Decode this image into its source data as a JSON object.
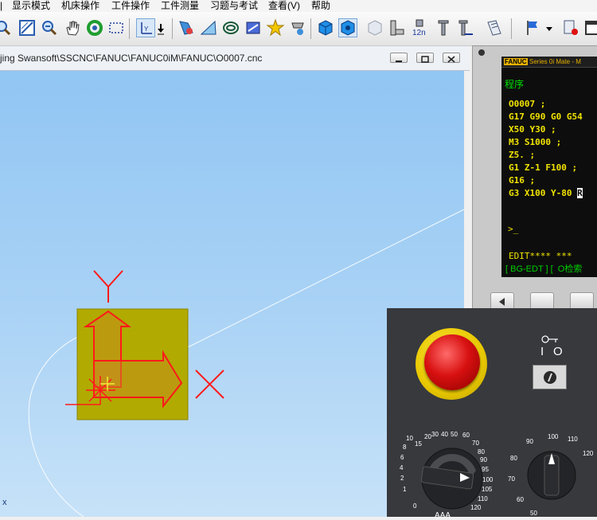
{
  "menu": {
    "items": [
      "显示模式",
      "机床操作",
      "工件操作",
      "工件测量",
      "习题与考试",
      "查看(V)",
      "帮助"
    ]
  },
  "toolbar": {
    "icons": [
      "zoom-icon",
      "zoom-window-icon",
      "zoom-fit-icon",
      "pan-hand-icon",
      "rotate-icon",
      "select-box-icon",
      "axis-view-icon",
      "dropdown-icon",
      "tool-measure-icon",
      "ruler-icon",
      "spiral-icon",
      "workpiece-icon",
      "star-icon",
      "coolant-icon",
      "blue-cube-icon",
      "blue-cube-alt-icon",
      "transparent-cube-icon",
      "spindle-12n-icon",
      "tool-length-icon",
      "tool-radius-icon",
      "notebook-icon",
      "flag-icon",
      "dropdown-icon-2",
      "record-icon",
      "window-toggle-icon"
    ]
  },
  "viewport": {
    "path": "jing Swansoft\\SSCNC\\FANUC\\FANUC0iM\\FANUC\\O0007.cnc",
    "axis_y": "Y",
    "axis_x": "X",
    "corner_label": "x"
  },
  "cnc": {
    "brand": "FANUC",
    "series": "Series 0i Mate - M",
    "title": "程序",
    "lines": [
      "O0007 ;",
      "G17 G90 G0 G54",
      "X50 Y30 ;",
      "M3 S1000 ;",
      "Z5. ;",
      "G1 Z-1 F100 ;",
      "G16 ;",
      "G3 X100 Y-80 "
    ],
    "cursor_char": "R",
    "prompt": ">_",
    "status": "EDIT**** ***",
    "softkeys": "[ BG-EDT ] [  O检索"
  },
  "panel": {
    "key_labels": [
      "I",
      "O"
    ],
    "feed_dial": [
      "0",
      "1",
      "2",
      "4",
      "6",
      "8",
      "10",
      "15",
      "20",
      "30",
      "40",
      "50",
      "60",
      "70",
      "80",
      "90",
      "95",
      "100",
      "105",
      "110",
      "120"
    ],
    "spindle_dial": [
      "50",
      "60",
      "70",
      "80",
      "90",
      "100",
      "110",
      "120"
    ],
    "bottom_glyphs": "AAA"
  },
  "colors": {
    "viewport_top": "#8fc4f3",
    "workpiece": "#b1aa00",
    "axis_red": "#ff1a1a",
    "cnc_text": "#f2e400",
    "cnc_green": "#00e000",
    "estop_red": "#d81010"
  }
}
